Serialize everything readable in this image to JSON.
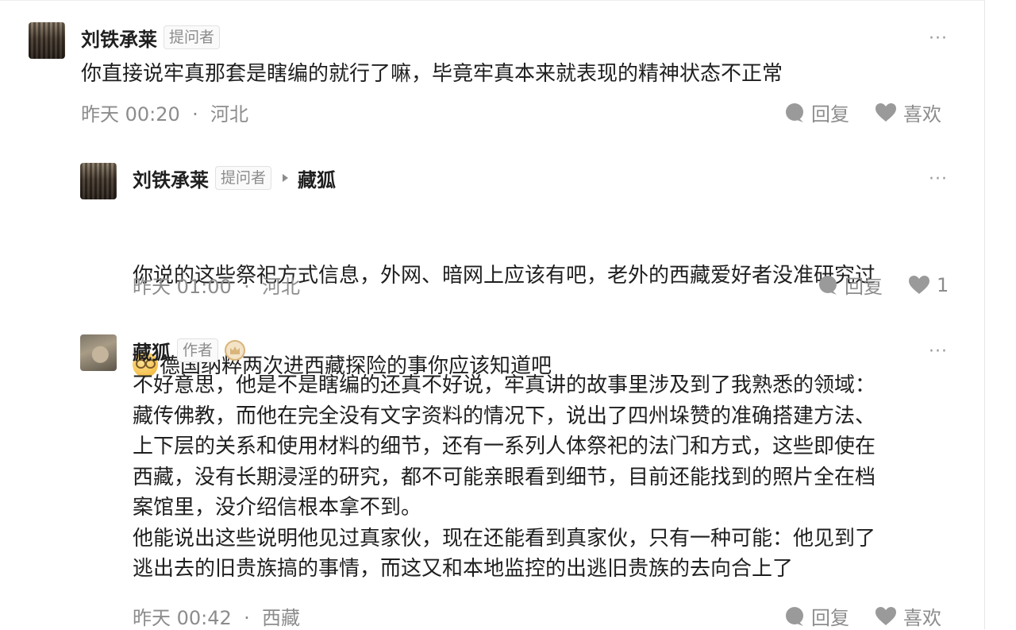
{
  "more_label": "···",
  "comments": [
    {
      "author": "刘铁承莱",
      "tag": "提问者",
      "reply_to": "",
      "content": "你直接说牢真那套是瞎编的就行了嘛，毕竟牢真本来就表现的精神状态不正常",
      "time": "昨天 00:20",
      "location": "河北",
      "reply_label": "回复",
      "like_label": "喜欢",
      "avatar_icon": "user-photo-icon"
    },
    {
      "author": "刘铁承莱",
      "tag": "提问者",
      "reply_to": "藏狐",
      "content_line1": "你说的这些祭祀方式信息，外网、暗网上应该有吧，老外的西藏爱好者没准研究过",
      "content_line2": "德国纳粹两次进西藏探险的事你应该知道吧",
      "emoji_icon": "nerd-face-icon",
      "time": "昨天 01:00",
      "location": "河北",
      "reply_label": "回复",
      "like_label": "1",
      "avatar_icon": "user-photo-icon"
    },
    {
      "author": "藏狐",
      "tag": "作者",
      "badge_icon": "crown-badge-icon",
      "content": "不好意思，他是不是瞎编的还真不好说，牢真讲的故事里涉及到了我熟悉的领域：\n藏传佛教，而他在完全没有文字资料的情况下，说出了四州垛赞的准确搭建方法、\n上下层的关系和使用材料的细节，还有一系列人体祭祀的法门和方式，这些即使在\n西藏，没有长期浸淫的研究，都不可能亲眼看到细节，目前还能找到的照片全在档\n案馆里，没介绍信根本拿不到。\n他能说出这些说明他见过真家伙，现在还能看到真家伙，只有一种可能：他见到了\n逃出去的旧贵族搞的事情，而这又和本地监控的出逃旧贵族的去向合上了",
      "time": "昨天 00:42",
      "location": "西藏",
      "reply_label": "回复",
      "like_label": "喜欢",
      "avatar_icon": "fox-photo-icon"
    }
  ],
  "colors": {
    "text": "#1f1f1f",
    "meta": "#8c8c8c",
    "icon": "#9a9a9a",
    "badge": "#d9b47b"
  }
}
